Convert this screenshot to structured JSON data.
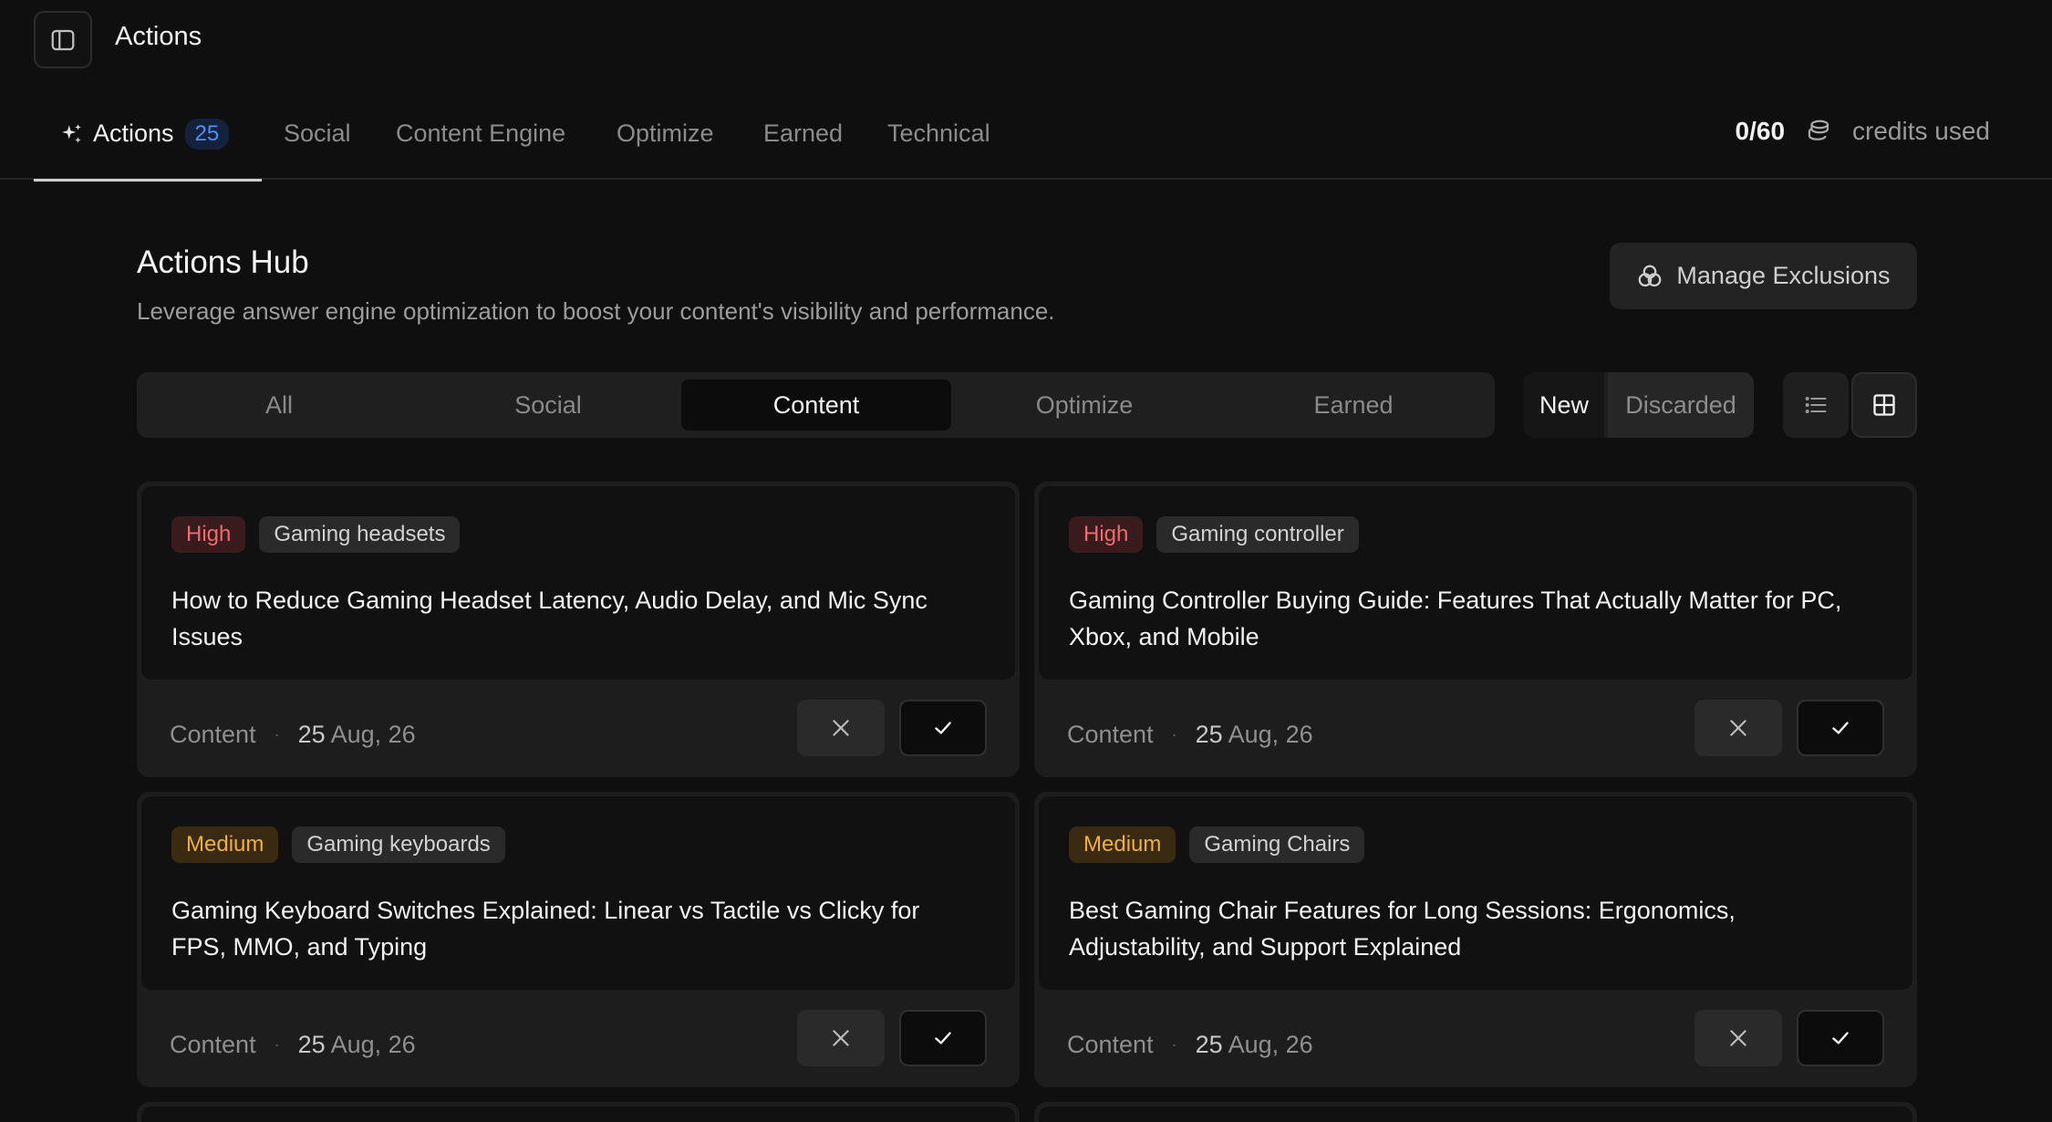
{
  "header": {
    "title": "Actions"
  },
  "nav": {
    "tabs": [
      {
        "label": "Actions",
        "count": "25",
        "active": true
      },
      {
        "label": "Social"
      },
      {
        "label": "Content Engine"
      },
      {
        "label": "Optimize"
      },
      {
        "label": "Earned"
      },
      {
        "label": "Technical"
      }
    ],
    "credits": {
      "used": "0/60",
      "label": "credits used"
    }
  },
  "hub": {
    "title": "Actions Hub",
    "subtitle": "Leverage answer engine optimization to boost your content's visibility and performance.",
    "manage_label": "Manage Exclusions"
  },
  "filters": {
    "categories": [
      "All",
      "Social",
      "Content",
      "Optimize",
      "Earned"
    ],
    "active_category": "Content",
    "status": {
      "new": "New",
      "discarded": "Discarded"
    }
  },
  "cards": [
    {
      "priority": "High",
      "topic": "Gaming headsets",
      "title": "How to Reduce Gaming Headset Latency, Audio Delay, and Mic Sync Issues",
      "type": "Content",
      "day": "25",
      "date": "Aug, 26"
    },
    {
      "priority": "High",
      "topic": "Gaming controller",
      "title": "Gaming Controller Buying Guide: Features That Actually Matter for PC, Xbox, and Mobile",
      "type": "Content",
      "day": "25",
      "date": "Aug, 26"
    },
    {
      "priority": "Medium",
      "topic": "Gaming keyboards",
      "title": "Gaming Keyboard Switches Explained: Linear vs Tactile vs Clicky for FPS, MMO, and Typing",
      "type": "Content",
      "day": "25",
      "date": "Aug, 26"
    },
    {
      "priority": "Medium",
      "topic": "Gaming Chairs",
      "title": "Best Gaming Chair Features for Long Sessions: Ergonomics, Adjustability, and Support Explained",
      "type": "Content",
      "day": "25",
      "date": "Aug, 26"
    }
  ],
  "icons": {
    "sidebar_toggle": "sidebar-panel-icon",
    "actions_tab": "sparkles-icon",
    "credits": "coins-icon",
    "manage": "exclusions-circles-icon",
    "list_view": "list-icon",
    "grid_view": "grid-icon",
    "discard": "close-icon",
    "accept": "check-icon"
  },
  "colors": {
    "background": "#0f0f0f",
    "accent_badge": "#4f8ff6",
    "high": "#f06b6b",
    "medium": "#efb13d"
  }
}
